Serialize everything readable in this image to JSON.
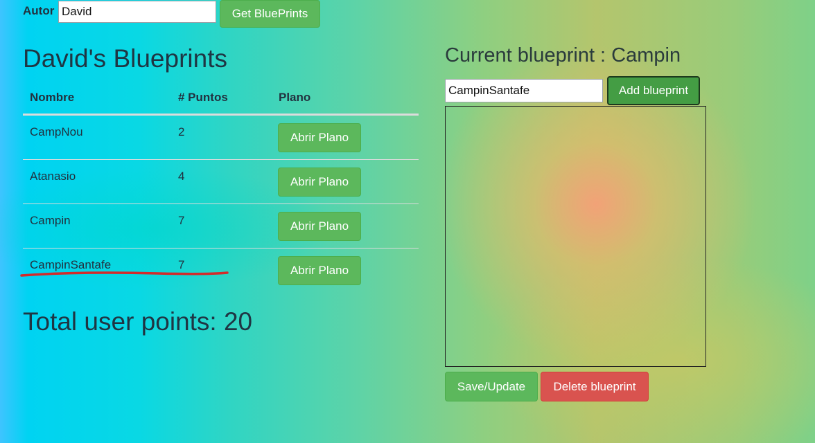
{
  "search": {
    "author_label": "Autor",
    "author_value": "David",
    "get_button": "Get BluePrints"
  },
  "blueprints": {
    "title": "David's Blueprints",
    "columns": [
      "Nombre",
      "# Puntos",
      "Plano"
    ],
    "rows": [
      {
        "name": "CampNou",
        "points": "2",
        "action": "Abrir Plano"
      },
      {
        "name": "Atanasio",
        "points": "4",
        "action": "Abrir Plano"
      },
      {
        "name": "Campin",
        "points": "7",
        "action": "Abrir Plano"
      },
      {
        "name": "CampinSantafe",
        "points": "7",
        "action": "Abrir Plano"
      }
    ],
    "total_label": "Total user points: ",
    "total_value": "20"
  },
  "current": {
    "title_label": "Current blueprint : ",
    "title_value": "Campin",
    "name_input_value": "CampinSantafe",
    "add_button": "Add blueprint",
    "save_button": "Save/Update",
    "delete_button": "Delete blueprint"
  },
  "colors": {
    "green_button": "#5cb85c",
    "red_button": "#d9534f",
    "underline_mark": "#d22b2b"
  }
}
